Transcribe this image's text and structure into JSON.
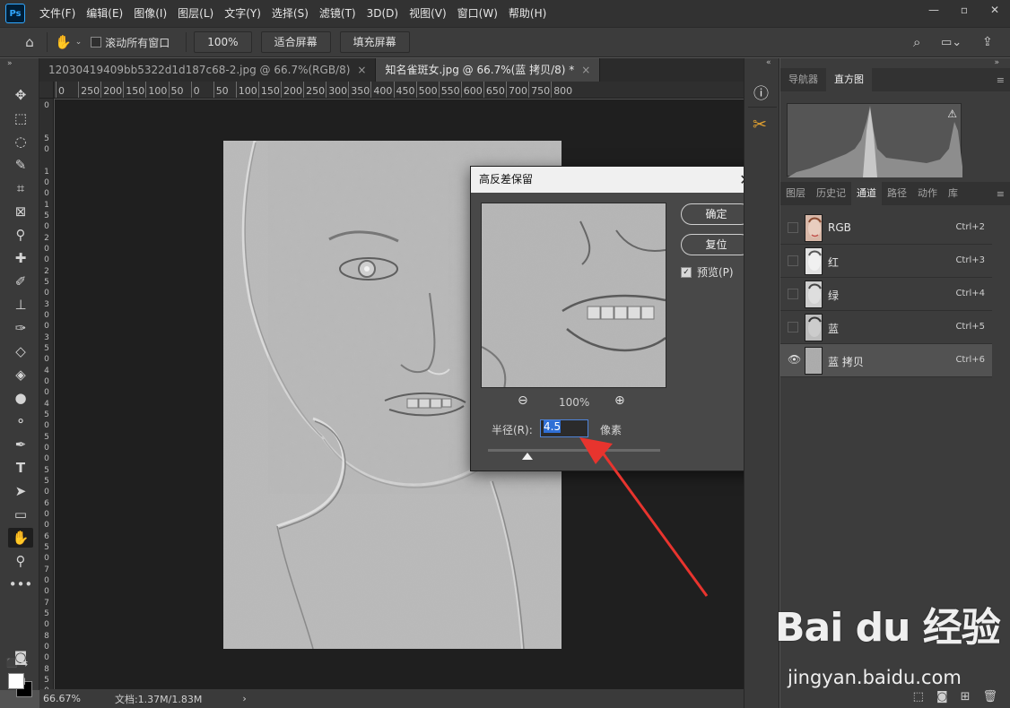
{
  "app": {
    "logo": "Ps"
  },
  "menu": [
    "文件(F)",
    "编辑(E)",
    "图像(I)",
    "图层(L)",
    "文字(Y)",
    "选择(S)",
    "滤镜(T)",
    "3D(D)",
    "视图(V)",
    "窗口(W)",
    "帮助(H)"
  ],
  "options_bar": {
    "scroll_all_label": "滚动所有窗口",
    "zoom_value": "100%",
    "fit_screen": "适合屏幕",
    "fill_screen": "填充屏幕"
  },
  "tabs": [
    {
      "label": "12030419409bb5322d1d187c68-2.jpg @ 66.7%(RGB/8)",
      "close": "×"
    },
    {
      "label": "知名雀斑女.jpg @ 66.7%(蓝 拷贝/8) *",
      "close": "×"
    }
  ],
  "ruler": {
    "h_labels": [
      "0",
      "250",
      "200",
      "150",
      "100",
      "50",
      "0",
      "50",
      "100",
      "150",
      "200",
      "250",
      "300",
      "350",
      "400",
      "450",
      "500",
      "550",
      "600",
      "650",
      "700",
      "750",
      "800"
    ],
    "v_labels": [
      "0",
      "5 0",
      "1 0 0",
      "1 5 0",
      "2 0 0",
      "2 5 0",
      "3 0 0",
      "3 5 0",
      "4 0 0",
      "4 5 0",
      "5 0 0",
      "5 5 0",
      "6 0 0",
      "6 5 0",
      "7 0 0",
      "7 5 0",
      "8 0 0",
      "8 5 0"
    ]
  },
  "status": {
    "zoom": "66.67%",
    "doc": "文档:1.37M/1.83M",
    "arrow": "›"
  },
  "dialog": {
    "title": "高反差保留",
    "close": "✕",
    "ok": "确定",
    "reset": "复位",
    "preview_label": "预览(P)",
    "zoom": "100%",
    "radius_label": "半径(R):",
    "radius_value": "4.5",
    "radius_unit": "像素",
    "radius_fraction": 0.23
  },
  "panels": {
    "top_tabs": [
      "导航器",
      "直方图"
    ],
    "bottom_tabs": [
      "图层",
      "历史记",
      "通道",
      "路径",
      "动作",
      "库"
    ],
    "channels": [
      {
        "name": "RGB",
        "shortcut": "Ctrl+2",
        "visible": false
      },
      {
        "name": "红",
        "shortcut": "Ctrl+3",
        "visible": false
      },
      {
        "name": "绿",
        "shortcut": "Ctrl+4",
        "visible": false
      },
      {
        "name": "蓝",
        "shortcut": "Ctrl+5",
        "visible": false
      },
      {
        "name": "蓝 拷贝",
        "shortcut": "Ctrl+6",
        "visible": true
      }
    ]
  },
  "watermark": {
    "logo": "Bai du 经验",
    "url": "jingyan.baidu.com"
  },
  "colors": {
    "accent": "#31a8ff",
    "arrow": "#e8342e",
    "selection": "#2f6fd6"
  }
}
